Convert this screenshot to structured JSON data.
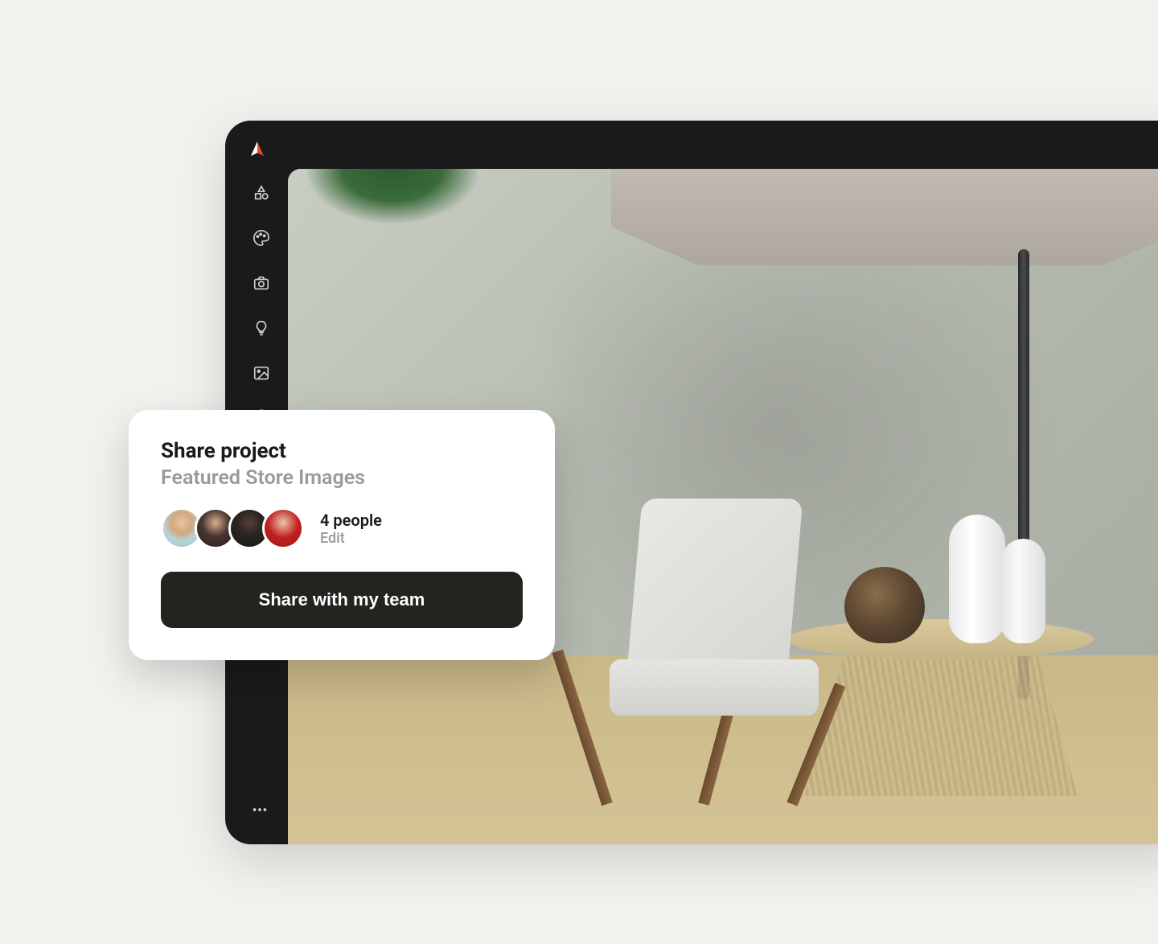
{
  "toolbar": {
    "icons": [
      "shapes-icon",
      "palette-icon",
      "camera-icon",
      "lightbulb-icon",
      "image-icon",
      "settings-icon"
    ],
    "more_icon": "more-horizontal-icon"
  },
  "share_dialog": {
    "title": "Share project",
    "subtitle": "Featured Store Images",
    "people_count": "4 people",
    "edit_label": "Edit",
    "button_label": "Share with my team",
    "avatars": [
      {
        "name": "person-1"
      },
      {
        "name": "person-2"
      },
      {
        "name": "person-3"
      },
      {
        "name": "person-4"
      }
    ]
  }
}
